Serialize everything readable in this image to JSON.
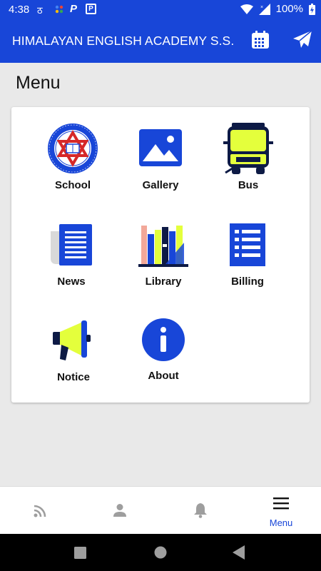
{
  "status_bar": {
    "time": "4:38",
    "battery": "100%",
    "note_icon": "ठ",
    "p_icon": "P"
  },
  "app_bar": {
    "title": "HIMALAYAN ENGLISH ACADEMY S.S.",
    "calendar_icon": "calendar-icon",
    "send_icon": "send-icon"
  },
  "page": {
    "heading": "Menu"
  },
  "menu": {
    "items": [
      {
        "label": "School",
        "icon": "school-logo-icon"
      },
      {
        "label": "Gallery",
        "icon": "gallery-icon"
      },
      {
        "label": "Bus",
        "icon": "bus-icon"
      },
      {
        "label": "News",
        "icon": "news-icon"
      },
      {
        "label": "Library",
        "icon": "library-icon"
      },
      {
        "label": "Billing",
        "icon": "billing-icon"
      },
      {
        "label": "Notice",
        "icon": "megaphone-icon"
      },
      {
        "label": "About",
        "icon": "info-icon"
      }
    ]
  },
  "bottom_nav": {
    "items": [
      {
        "label": "",
        "icon": "rss-icon"
      },
      {
        "label": "",
        "icon": "person-icon"
      },
      {
        "label": "",
        "icon": "bell-icon"
      },
      {
        "label": "Menu",
        "icon": "hamburger-icon",
        "active": true
      }
    ]
  },
  "colors": {
    "primary": "#1846d8",
    "accent": "#e4ff3c",
    "dark": "#0d1a45"
  }
}
